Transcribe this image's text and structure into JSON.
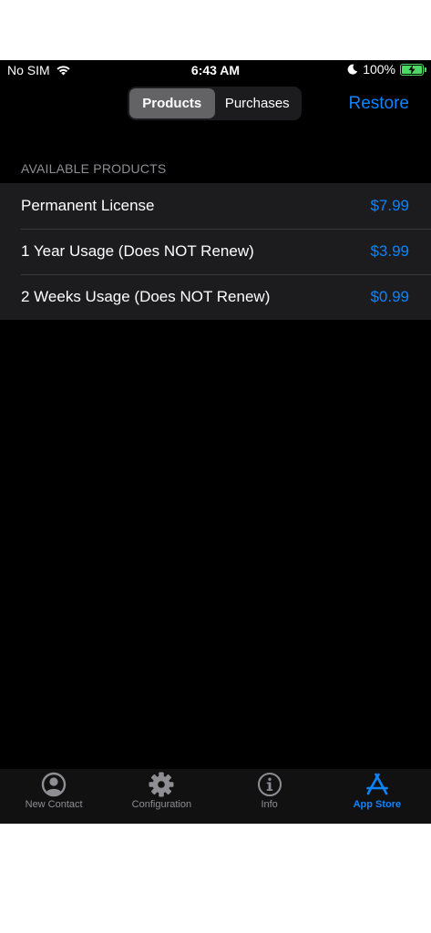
{
  "status_bar": {
    "carrier": "No SIM",
    "time": "6:43 AM",
    "battery": "100%",
    "battery_level": 1.0
  },
  "nav": {
    "segments": [
      {
        "label": "Products",
        "selected": true
      },
      {
        "label": "Purchases",
        "selected": false
      }
    ],
    "restore_label": "Restore"
  },
  "products": {
    "section_header": "AVAILABLE PRODUCTS",
    "items": [
      {
        "name": "Permanent License",
        "price": "$7.99"
      },
      {
        "name": "1 Year Usage (Does NOT Renew)",
        "price": "$3.99"
      },
      {
        "name": "2 Weeks Usage (Does NOT Renew)",
        "price": "$0.99"
      }
    ]
  },
  "tab_bar": {
    "items": [
      {
        "label": "New Contact",
        "icon": "person-circle-icon",
        "active": false
      },
      {
        "label": "Configuration",
        "icon": "gear-icon",
        "active": false
      },
      {
        "label": "Info",
        "icon": "info-circle-icon",
        "active": false
      },
      {
        "label": "App Store",
        "icon": "app-store-icon",
        "active": true
      }
    ]
  },
  "colors": {
    "accent": "#0a84ff",
    "background": "#000000",
    "cell": "#1c1c1e",
    "battery": "#4cd964"
  }
}
